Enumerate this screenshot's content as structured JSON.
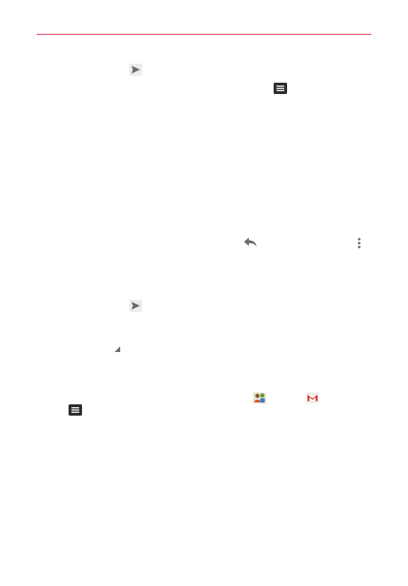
{
  "colors": {
    "header_rule": "#c8102e",
    "icon_gray": "#6b6b6b",
    "icon_dark": "#2b2b2b",
    "icon_bg": "#ececec"
  },
  "icons": [
    "send-icon",
    "menu-icon",
    "reply-icon",
    "overflow-menu-icon",
    "send-icon",
    "resize-handle-icon",
    "contacts-app-icon",
    "gmail-app-icon",
    "menu-icon"
  ]
}
